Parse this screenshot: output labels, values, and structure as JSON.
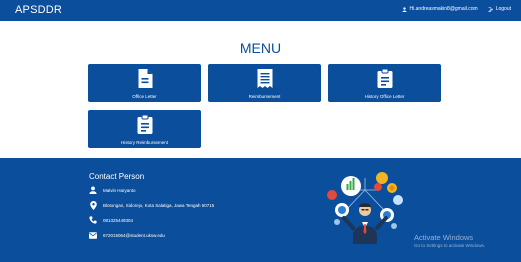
{
  "app": {
    "brand": "APSDDR"
  },
  "user": {
    "email": "Hi.andreasmakin8@gmail.com",
    "logout_label": "Logout"
  },
  "menu": {
    "title": "MENU",
    "tiles": [
      {
        "label": "Office Letter",
        "icon": "document-icon"
      },
      {
        "label": "Reimbursement",
        "icon": "receipt-icon"
      },
      {
        "label": "History Office Letter",
        "icon": "clipboard-icon"
      },
      {
        "label": "History Reimbursement",
        "icon": "clipboard-icon"
      }
    ]
  },
  "footer": {
    "title": "Contact Person",
    "name": "Malvin Haryanto",
    "address": "Blotongan, Sidorejo, Kota Salatiga, Jawa Tengah 50715",
    "phone": "081325449304",
    "email": "672015064@student.uksw.edu"
  },
  "watermark": {
    "title": "Activate Windows",
    "subtitle": "Go to Settings to activate Windows."
  },
  "colors": {
    "primary": "#0a4e9c",
    "background": "#ffffff",
    "text_light": "#ffffff"
  }
}
